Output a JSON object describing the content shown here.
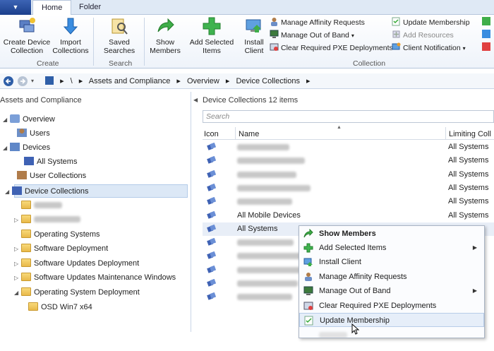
{
  "app_menu": {
    "label": "▼"
  },
  "ribbon_tabs": [
    "Home",
    "Folder"
  ],
  "ribbon": {
    "create_device_collection": "Create Device Collection",
    "import_collections": "Import Collections",
    "saved_searches": "Saved Searches",
    "show_members": "Show Members",
    "add_selected_items": "Add Selected Items",
    "install_client": "Install Client",
    "manage_affinity_requests": "Manage Affinity Requests",
    "manage_out_of_band": "Manage Out of Band",
    "clear_required_pxe": "Clear Required PXE Deployments",
    "update_membership": "Update Membership",
    "add_resources": "Add Resources",
    "client_notification": "Client Notification",
    "group_create": "Create",
    "group_search": "Search",
    "group_collection": "Collection"
  },
  "address": {
    "root": "\\",
    "crumbs": [
      "Assets and Compliance",
      "Overview",
      "Device Collections"
    ]
  },
  "left_pane": {
    "title": "Assets and Compliance",
    "items": [
      {
        "label": "Overview"
      },
      {
        "label": "Users"
      },
      {
        "label": "Devices"
      },
      {
        "label": "All Systems"
      },
      {
        "label": "User Collections"
      },
      {
        "label": "Device Collections"
      },
      {
        "label": ""
      },
      {
        "label": ""
      },
      {
        "label": "Operating Systems"
      },
      {
        "label": "Software Deployment"
      },
      {
        "label": "Software Updates Deployment"
      },
      {
        "label": "Software Updates Maintenance Windows"
      },
      {
        "label": "Operating System Deployment"
      },
      {
        "label": "OSD Win7 x64"
      }
    ]
  },
  "right_pane": {
    "title": "Device Collections 12 items",
    "search_placeholder": "Search",
    "columns": {
      "icon": "Icon",
      "name": "Name",
      "limiting": "Limiting Coll"
    },
    "rows": [
      {
        "name": "",
        "limiting": "All Systems"
      },
      {
        "name": "",
        "limiting": "All Systems"
      },
      {
        "name": "",
        "limiting": "All Systems"
      },
      {
        "name": "",
        "limiting": "All Systems"
      },
      {
        "name": "",
        "limiting": "All Systems"
      },
      {
        "name": "All Mobile Devices",
        "limiting": "All Systems"
      },
      {
        "name": "All Systems",
        "limiting": ""
      },
      {
        "name": "",
        "limiting": ""
      },
      {
        "name": "",
        "limiting": ""
      },
      {
        "name": "",
        "limiting": ""
      },
      {
        "name": "",
        "limiting": ""
      },
      {
        "name": "",
        "limiting": ""
      }
    ]
  },
  "context_menu": {
    "items": [
      {
        "label": "Show Members",
        "submenu": false
      },
      {
        "label": "Add Selected Items",
        "submenu": true
      },
      {
        "label": "Install Client",
        "submenu": false
      },
      {
        "label": "Manage Affinity Requests",
        "submenu": false
      },
      {
        "label": "Manage Out of Band",
        "submenu": true
      },
      {
        "label": "Clear Required PXE Deployments",
        "submenu": false
      },
      {
        "label": "Update Membership",
        "submenu": false
      }
    ]
  },
  "colors": {
    "accent": "#1c3f8c",
    "selection": "#dce8f6",
    "hover": "#e6eef9"
  }
}
